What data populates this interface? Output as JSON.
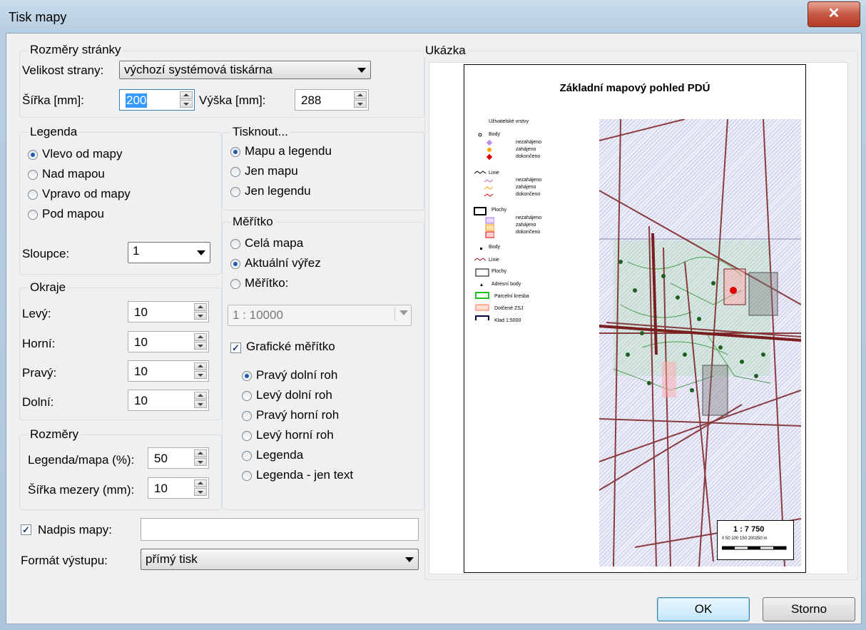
{
  "window": {
    "title": "Tisk mapy",
    "close_glyph": "✕"
  },
  "page_size": {
    "group": "Rozměry stránky",
    "size_label": "Velikost strany:",
    "size_value": "výchozí systémová tiskárna",
    "width_label": "Šířka [mm]:",
    "width_value": "200",
    "height_label": "Výška [mm]:",
    "height_value": "288"
  },
  "legend": {
    "group": "Legenda",
    "options": [
      "Vlevo od mapy",
      "Nad mapou",
      "Vpravo od mapy",
      "Pod mapou"
    ],
    "selected": "Vlevo od mapy",
    "columns_label": "Sloupce:",
    "columns_value": "1"
  },
  "print_what": {
    "group": "Tisknout...",
    "options": [
      "Mapu a legendu",
      "Jen mapu",
      "Jen legendu"
    ],
    "selected": "Mapu a legendu"
  },
  "scale": {
    "group": "Měřítko",
    "options": [
      "Celá mapa",
      "Aktuální výřez",
      "Měřítko:"
    ],
    "selected": "Aktuální výřez",
    "scale_value": "1 : 10000",
    "graphic_scale_label": "Grafické měřítko",
    "graphic_scale_checked": true,
    "positions": [
      "Pravý dolní roh",
      "Levý dolní roh",
      "Pravý horní roh",
      "Levý horní roh",
      "Legenda",
      "Legenda - jen text"
    ],
    "position_selected": "Pravý dolní roh"
  },
  "margins": {
    "group": "Okraje",
    "left_label": "Levý:",
    "left_value": "10",
    "top_label": "Horní:",
    "top_value": "10",
    "right_label": "Pravý:",
    "right_value": "10",
    "bottom_label": "Dolní:",
    "bottom_value": "10"
  },
  "dimensions": {
    "group": "Rozměry",
    "legend_map_label": "Legenda/mapa (%):",
    "legend_map_value": "50",
    "gap_label": "Šířka mezery (mm):",
    "gap_value": "10"
  },
  "map_caption": {
    "label": "Nadpis mapy:",
    "checked": true,
    "value": ""
  },
  "output": {
    "label": "Formát výstupu:",
    "value": "přímý tisk"
  },
  "preview": {
    "group": "Ukázka",
    "title": "Základní mapový pohled PDÚ",
    "legend_items": [
      "Uživatelské vrstvy",
      "Body",
      "nezahájeno",
      "zahájeno",
      "dokončeno",
      "Linie",
      "nezahájeno",
      "zahájeno",
      "dokončeno",
      "Plochy",
      "nezahájeno",
      "zahájeno",
      "dokončeno",
      "Body",
      "Linie",
      "Plochy",
      "Adresní body",
      "Parcelní kresba",
      "Dotčené ZSJ",
      "Klad 1:5000"
    ],
    "scale_text": "1 : 7 750",
    "scale_ticks": "0  50  100 150 200250 m"
  },
  "buttons": {
    "ok": "OK",
    "cancel": "Storno"
  },
  "colors": {
    "accent": "#1e5bb3",
    "close": "#c75a45",
    "map_roads": "#7a1f1f",
    "map_green": "#2f8f2f"
  }
}
